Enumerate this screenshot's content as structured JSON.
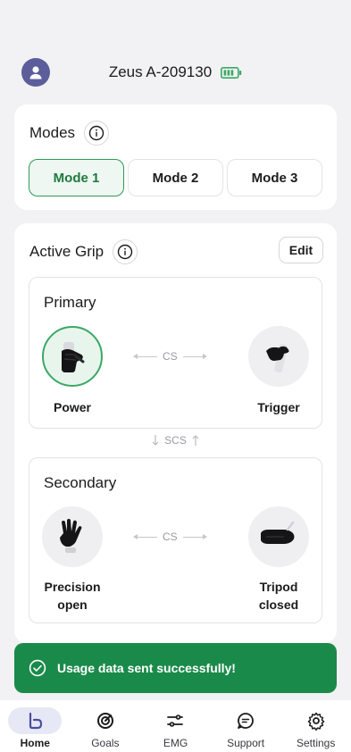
{
  "header": {
    "device_name": "Zeus A-209130"
  },
  "modes": {
    "title": "Modes",
    "items": [
      {
        "label": "Mode 1",
        "active": true
      },
      {
        "label": "Mode 2",
        "active": false
      },
      {
        "label": "Mode 3",
        "active": false
      }
    ]
  },
  "active_grip": {
    "title": "Active Grip",
    "edit_label": "Edit",
    "primary": {
      "label": "Primary",
      "left_grip": "Power",
      "right_grip": "Trigger",
      "connector": "CS"
    },
    "switch_label": "SCS",
    "secondary": {
      "label": "Secondary",
      "left_grip_line1": "Precision",
      "left_grip_line2": "open",
      "right_grip_line1": "Tripod",
      "right_grip_line2": "closed",
      "connector": "CS"
    }
  },
  "toast": {
    "message": "Usage data sent successfully!"
  },
  "tabs": [
    {
      "label": "Home",
      "icon": "home-icon",
      "active": true
    },
    {
      "label": "Goals",
      "icon": "goals-icon",
      "active": false
    },
    {
      "label": "EMG",
      "icon": "emg-icon",
      "active": false
    },
    {
      "label": "Support",
      "icon": "support-icon",
      "active": false
    },
    {
      "label": "Settings",
      "icon": "gear-icon",
      "active": false
    }
  ],
  "colors": {
    "accent_green": "#2e9b57",
    "toast_green": "#1a8a4a",
    "avatar": "#5b5e9a",
    "battery": "#3aa866"
  }
}
